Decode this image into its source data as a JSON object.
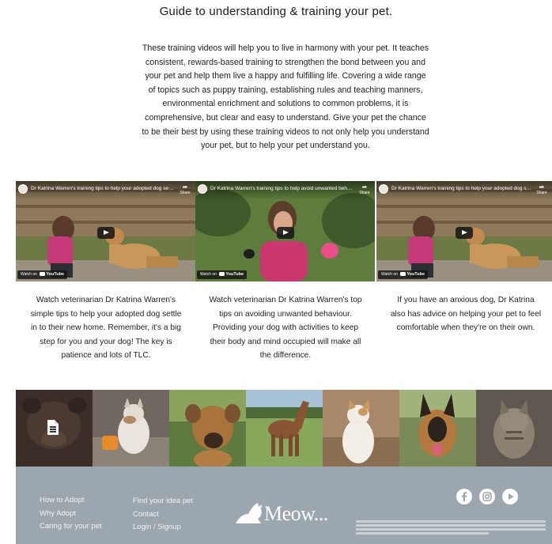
{
  "page": {
    "title": "Guide to understanding & training your pet.",
    "intro": "These training videos will help you to live in harmony with your pet. It teaches consistent, rewards-based training to strengthen the bond between you and your pet and help them live a happy and fulfilling life. Covering a wide range of topics such as puppy training, establishing rules and teaching manners, environmental enrichment and solutions to common problems, it is comprehensive, but clear and easy to understand. Give your pet the chance to be their best by using these training videos to not only help you understand your pet, but to help your pet understand you."
  },
  "videos": [
    {
      "title": "Dr Katrina Warren's training tips to help your adopted dog settle in",
      "share": "Share",
      "watch_on": "Watch on",
      "youtube": "YouTube",
      "caption": "Watch veterinarian Dr Katrina Warren's simple tips to help your adopted dog settle in to their new home. Remember, it's a big step for you and your dog! The key is patience and lots of TLC."
    },
    {
      "title": "Dr Katrina Warren's training tips to help avoid unwanted behaviour",
      "share": "Share",
      "watch_on": "Watch on",
      "youtube": "YouTube",
      "caption": "Watch veterinarian Dr Katrina Warren's top tips on avoiding unwanted behaviour. Providing your dog with activities to keep their body and mind occupied will make all the difference."
    },
    {
      "title": "Dr Katrina Warren's training tips to help your adopted dog settle in",
      "share": "Share",
      "watch_on": "Watch on",
      "youtube": "YouTube",
      "caption": "If you have an anxious dog, Dr Katrina also has advice on helping your pet to feel comfortable when they're on their own."
    }
  ],
  "gallery": [
    {
      "icon": "document-icon",
      "subject": "dog"
    },
    {
      "subject": "cat"
    },
    {
      "subject": "dog"
    },
    {
      "subject": "horse"
    },
    {
      "subject": "cat"
    },
    {
      "subject": "dog"
    },
    {
      "subject": "cat"
    }
  ],
  "footer": {
    "col1": [
      "How to Adopt",
      "Why Adopt",
      "Caring for your pet"
    ],
    "col2": [
      "Find your idea pet",
      "Contact",
      "Login / Signup"
    ],
    "logo_text": "Meow...",
    "social": [
      "facebook-icon",
      "instagram-icon",
      "youtube-icon"
    ],
    "colors": {
      "footer_bg": "#9ba6ae",
      "footer_text": "#f2f4f5"
    }
  }
}
